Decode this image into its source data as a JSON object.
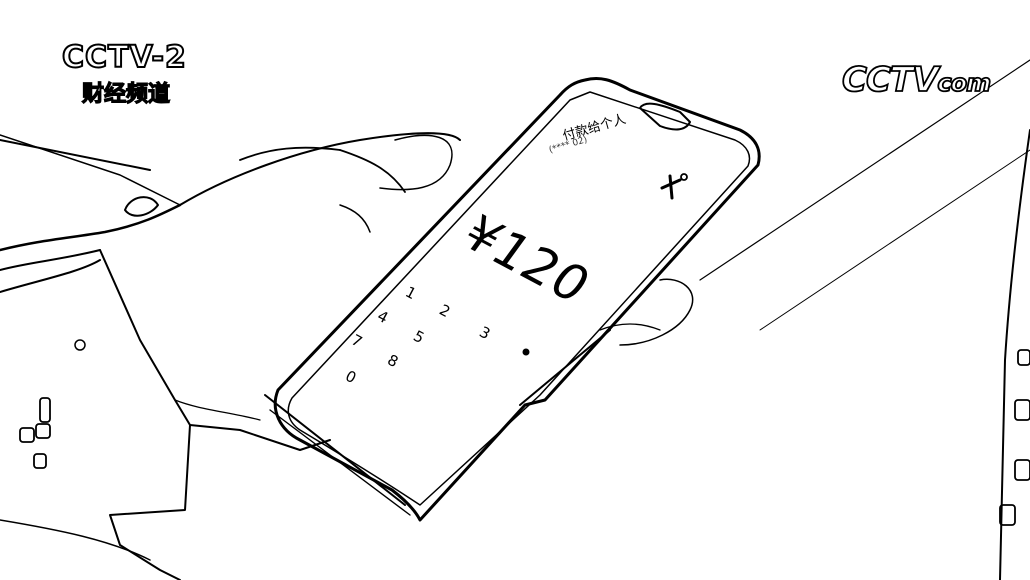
{
  "overlay": {
    "channel_logo": "CCTV-2",
    "channel_subtitle": "财经频道",
    "watermark_logo": "CCTV",
    "watermark_suffix": "com"
  },
  "phone": {
    "payee_label": "付款给个人",
    "payee_detail": "(**** 02)",
    "amount": "¥120",
    "keypad": [
      "1",
      "2",
      "3",
      "4",
      "5",
      "7",
      "8",
      "0"
    ]
  },
  "colors": {
    "line": "#000000",
    "background": "#ffffff"
  }
}
